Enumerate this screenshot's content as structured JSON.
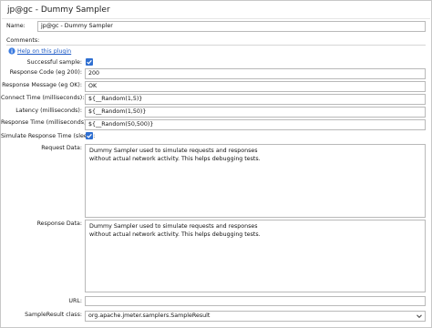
{
  "window": {
    "title": "jp@gc - Dummy Sampler"
  },
  "name_field": {
    "label": "Name:",
    "value": "jp@gc - Dummy Sampler"
  },
  "comments_field": {
    "label": "Comments:",
    "value": ""
  },
  "help_link": {
    "label": "Help on this plugin",
    "icon": "help-info-icon"
  },
  "successful_sample": {
    "label": "Successful sample:",
    "checked": true
  },
  "response_code": {
    "label": "Response Code (eg 200):",
    "value": "200"
  },
  "response_message": {
    "label": "Response Message (eg OK):",
    "value": "OK"
  },
  "connect_time": {
    "label": "Connect Time (milliseconds):",
    "value": "${__Random(1,5)}"
  },
  "latency": {
    "label": "Latency (milliseconds):",
    "value": "${__Random(1,50)}"
  },
  "response_time": {
    "label": "Response Time (milliseconds):",
    "value": "${__Random(50,500)}"
  },
  "simulate_response_time": {
    "label": "Simulate Response Time (sleep):",
    "checked": true
  },
  "request_data": {
    "label": "Request Data:",
    "value": "Dummy Sampler used to simulate requests and responses\nwithout actual network activity. This helps debugging tests."
  },
  "response_data": {
    "label": "Response Data:",
    "value": "Dummy Sampler used to simulate requests and responses\nwithout actual network activity. This helps debugging tests."
  },
  "url_field": {
    "label": "URL:",
    "value": ""
  },
  "sampleresult_class": {
    "label": "SampleResult class:",
    "value": "org.apache.jmeter.samplers.SampleResult",
    "icon": "chevron-down-icon"
  },
  "colors": {
    "accent": "#2f6fd1",
    "link": "#1b58c4",
    "border": "#b9b9b9"
  }
}
